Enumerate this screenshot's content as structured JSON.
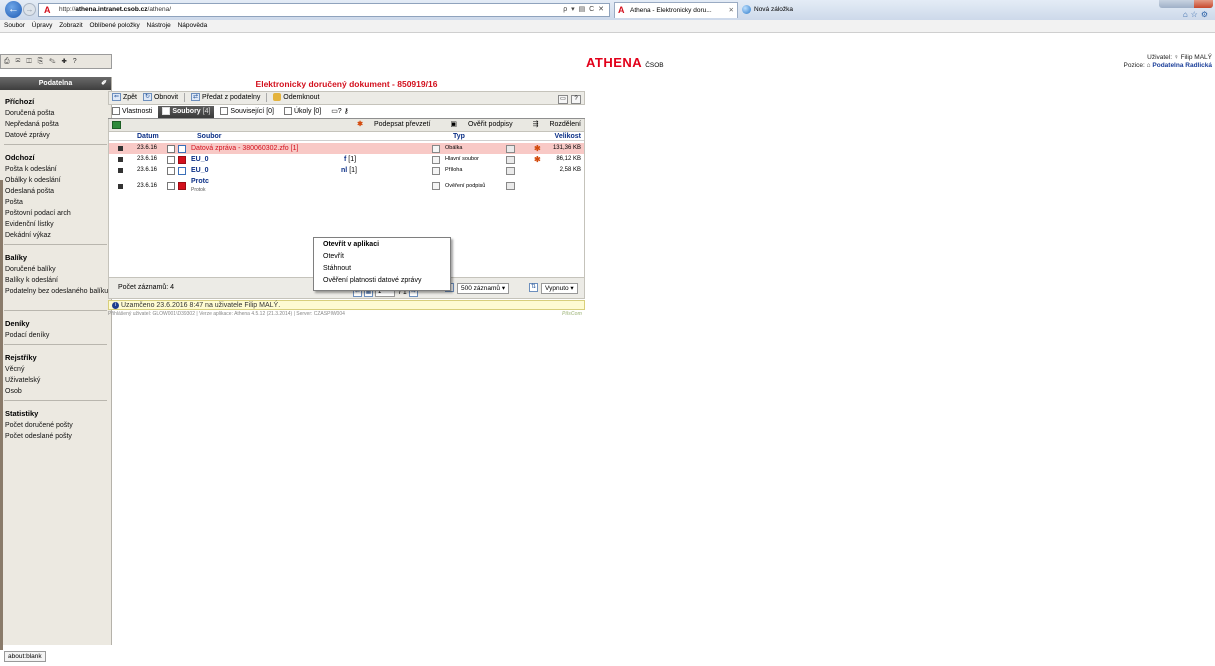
{
  "browser": {
    "url_prefix": "http://",
    "url_host": "athena.intranet.csob.cz",
    "url_path": "/athena/",
    "addr_tools": "ρ ▾ ▤ C ✕",
    "tab_active": "Athena - Elektronicky doru...",
    "tab_new": "Nová záložka",
    "status": "about:blank"
  },
  "menu": [
    "Soubor",
    "Úpravy",
    "Zobrazit",
    "Oblíbené položky",
    "Nástroje",
    "Nápověda"
  ],
  "app": {
    "logo": "ATHENA",
    "logo_sub": "ČSOB",
    "user_label": "Uživatel:",
    "user_name": "Filip MALÝ",
    "position_label": "Pozice:",
    "position_name": "Podatelna Radlická",
    "toolbar_icons": "⎙ ✉ ◫ ⎘ ✎ ✚ ? "
  },
  "sidebar": {
    "title": "Podatelna",
    "sections": [
      {
        "title": "Příchozí",
        "items": [
          "Doručená pošta",
          "Nepředaná pošta",
          "Datové zprávy"
        ]
      },
      {
        "title": "Odchozí",
        "items": [
          "Pošta k odeslání",
          "Obálky k odeslání",
          "Odeslaná pošta",
          "Pošta",
          "Poštovní podací arch",
          "Evidenční lístky",
          "Dekádní výkaz"
        ]
      },
      {
        "title": "Balíky",
        "items": [
          "Doručené balíky",
          "Balíky k odeslání",
          "Podatelny bez odeslaného balíku"
        ]
      },
      {
        "title": "Deníky",
        "items": [
          "Podací deníky"
        ]
      },
      {
        "title": "Rejstříky",
        "items": [
          "Věcný",
          "Uživatelský",
          "Osob"
        ]
      },
      {
        "title": "Statistiky",
        "items": [
          "Počet doručené pošty",
          "Počet odeslané pošty"
        ]
      }
    ]
  },
  "document": {
    "title": "Elektronicky doručený dokument - 850919/16",
    "actions": {
      "back": "Zpět",
      "refresh": "Obnovit",
      "handover": "Předat z podatelny",
      "unlock": "Odemknout"
    },
    "tabs": {
      "props": "Vlastnosti",
      "files": "Soubory",
      "files_count": "[4]",
      "related": "Související",
      "related_count": "[0]",
      "tasks": "Úkoly",
      "tasks_count": "[0]"
    },
    "files_actions": {
      "sign": "Podepsat převzetí",
      "verify": "Ověřit podpisy",
      "distribute": "Rozdělení"
    },
    "columns": {
      "date": "Datum",
      "file": "Soubor",
      "type": "Typ",
      "size": "Velikost"
    },
    "rows": [
      {
        "date": "23.6.16",
        "name": "Datová zpráva - 380060302.zfo",
        "count": "[1]",
        "type": "Obálka",
        "size": "131,36 KB",
        "seal": true
      },
      {
        "date": "23.6.16",
        "name": "EU_0",
        "name_suffix": "f",
        "count": "[1]",
        "type": "Hlavní soubor",
        "size": "86,12 KB",
        "seal": true
      },
      {
        "date": "23.6.16",
        "name": "EU_0",
        "name_suffix": "nl",
        "count": "[1]",
        "type": "Příloha",
        "size": "2,58 KB",
        "seal": false
      },
      {
        "date": "23.6.16",
        "name": "Protc",
        "name_sub": "Protok",
        "type": "Ověření podpisů",
        "size": "",
        "seal": false
      }
    ],
    "context_menu": [
      "Otevřít v aplikaci",
      "Otevřít",
      "Stáhnout",
      "Ověření platnosti datové zprávy"
    ],
    "pager": {
      "count_label": "Počet záznamů: 4",
      "page": "1",
      "of": "/ 1",
      "per_page": "500 záznamů",
      "sort": "Vypnuto"
    },
    "lock_msg": "Uzamčeno 23.6.2016 8:47 na uživatele Filip MALÝ.",
    "footer": "Přihlášený uživatel: GLOW001\\D39302  |  Verze aplikace: Athena 4.5.12 (21.3.2014)  |  Server: CZASPIW004",
    "footer_brand": "PilsCom"
  }
}
